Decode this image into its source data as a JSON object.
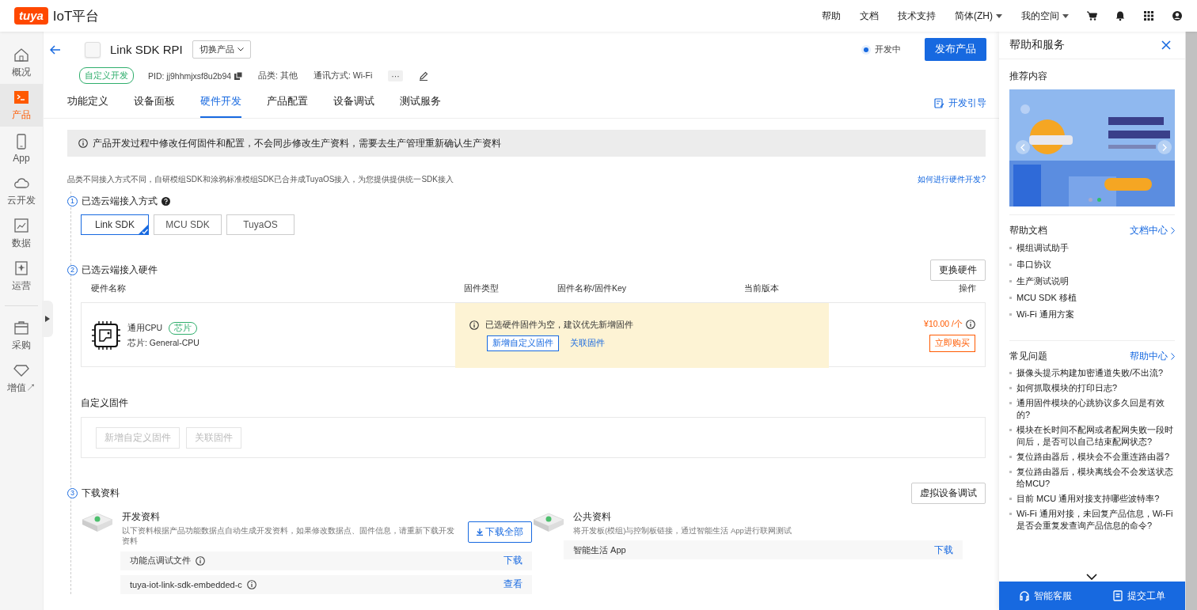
{
  "header": {
    "logo": "tuya",
    "title": "IoT平台",
    "links": [
      {
        "label": "帮助",
        "dropdown": false
      },
      {
        "label": "文档",
        "dropdown": false
      },
      {
        "label": "技术支持",
        "dropdown": false
      },
      {
        "label": "简体(ZH)",
        "dropdown": true
      },
      {
        "label": "我的空间",
        "dropdown": true
      }
    ]
  },
  "sidebar": {
    "items": [
      {
        "label": "概况",
        "selected": false
      },
      {
        "label": "产品",
        "selected": true
      },
      {
        "label": "App",
        "selected": false
      },
      {
        "label": "云开发",
        "selected": false
      },
      {
        "label": "数据",
        "selected": false
      },
      {
        "label": "运营",
        "selected": false
      },
      {
        "label": "采购",
        "selected": false
      },
      {
        "label": "增值↗",
        "selected": false
      }
    ]
  },
  "product": {
    "name": "Link SDK RPI",
    "switch_label": "切换产品",
    "tag": "自定义开发",
    "pid": "PID: jj9hhmjxsf8u2b94",
    "category": "品类: 其他",
    "protocol": "通讯方式: Wi-Fi",
    "more": "···",
    "status": "开发中",
    "publish": "发布产品"
  },
  "tabs": [
    {
      "label": "功能定义",
      "selected": false
    },
    {
      "label": "设备面板",
      "selected": false
    },
    {
      "label": "硬件开发",
      "selected": true
    },
    {
      "label": "产品配置",
      "selected": false
    },
    {
      "label": "设备调试",
      "selected": false
    },
    {
      "label": "测试服务",
      "selected": false
    }
  ],
  "guide_link": "开发引导",
  "notice": "产品开发过程中修改任何固件和配置，不会同步修改生产资料，需要去生产管理重新确认生产资料",
  "intro": "品类不同接入方式不同，自研模组SDK和涂鸦标准模组SDK已合并成TuyaOS接入，为您提供提供统一SDK接入",
  "help_link": "如何进行硬件开发?",
  "step1": {
    "number": "1",
    "title": "已选云端接入方式",
    "options": [
      {
        "label": "Link SDK",
        "selected": true
      },
      {
        "label": "MCU SDK",
        "selected": false
      },
      {
        "label": "TuyaOS",
        "selected": false
      }
    ]
  },
  "step2": {
    "number": "2",
    "title": "已选云端接入硬件",
    "button": "更换硬件",
    "columns": [
      "硬件名称",
      "固件类型",
      "固件名称/固件Key",
      "当前版本",
      "操作"
    ],
    "hardware": {
      "name": "通用CPU",
      "tag": "芯片",
      "chip": "芯片: General-CPU",
      "warning": "已选硬件固件为空，建议优先新增固件",
      "add_button": "新增自定义固件",
      "link": "关联固件",
      "price": "¥10.00 /个",
      "buy": "立即购买"
    }
  },
  "custom_firmware": {
    "title": "自定义固件",
    "buttons": [
      {
        "label": "新增自定义固件",
        "disabled": true
      },
      {
        "label": "关联固件",
        "disabled": true
      }
    ]
  },
  "step3": {
    "number": "3",
    "title": "下载资料",
    "button": "虚拟设备调试",
    "dev": {
      "title": "开发资料",
      "desc": "以下资料根据产品功能数据点自动生成开发资料，如果修改数据点、固件信息，请重新下载开发资料",
      "download_all": "下载全部",
      "files": [
        {
          "name": "功能点调试文件",
          "action": "下载"
        },
        {
          "name": "tuya-iot-link-sdk-embedded-c",
          "action": "查看"
        }
      ]
    },
    "public": {
      "title": "公共资料",
      "desc": "将开发板(模组)与控制板链接，通过智能生活 App进行联网测试",
      "files": [
        {
          "name": "智能生活 App",
          "action": "下载"
        }
      ]
    }
  },
  "help_panel": {
    "title": "帮助和服务",
    "recommend": "推荐内容",
    "banner": {
      "kind": "picture",
      "dots": [
        {
          "selected": false
        },
        {
          "selected": true
        }
      ]
    },
    "docs": {
      "title": "帮助文档",
      "more": "文档中心",
      "items": [
        "模组调试助手",
        "串口协议",
        "生产测试说明",
        "MCU SDK 移植",
        "Wi-Fi 通用方案"
      ]
    },
    "faq": {
      "title": "常见问题",
      "more": "帮助中心",
      "items": [
        "摄像头提示构建加密通道失败/不出流?",
        "如何抓取模块的打印日志?",
        "通用固件模块的心跳协议多久回是有效的?",
        "模块在长时间不配网或者配网失败一段时间后，是否可以自己结束配网状态?",
        "复位路由器后，模块会不会重连路由器?",
        "复位路由器后，模块离线会不会发送状态给MCU?",
        "目前 MCU 通用对接支持哪些波特率?",
        "Wi-Fi 通用对接，未回复产品信息，Wi-Fi是否会重复发查询产品信息的命令?"
      ]
    },
    "footer": [
      {
        "label": "智能客服"
      },
      {
        "label": "提交工单"
      }
    ]
  }
}
